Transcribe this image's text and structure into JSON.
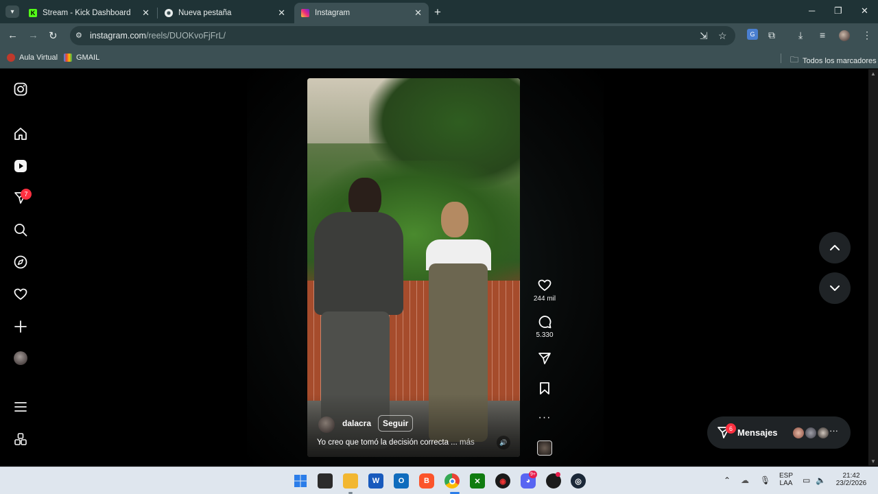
{
  "browser": {
    "tabs": [
      {
        "title": "Stream - Kick Dashboard",
        "favicon": "kick-icon",
        "color": "#53fc18"
      },
      {
        "title": "Nueva pestaña",
        "favicon": "chrome-icon",
        "color": "#e8edec"
      },
      {
        "title": "Instagram",
        "favicon": "instagram-icon",
        "color": "#e1306c",
        "active": true
      }
    ],
    "url_host": "instagram.com",
    "url_path": "/reels/DUOKvoFjFrL/",
    "bookmarks": [
      {
        "label": "Aula Virtual",
        "icon": "aula-virtual-icon"
      },
      {
        "label": "GMAIL",
        "icon": "gmail-icon"
      }
    ],
    "all_bookmarks_label": "Todos los marcadores"
  },
  "instagram": {
    "nav_badge_count": "7",
    "reel": {
      "username": "dalacra",
      "follow_label": "Seguir",
      "caption": "Yo creo que tomó la decisión correcta ...",
      "more_label": "más",
      "likes": "244 mil",
      "comments": "5.330"
    },
    "messages": {
      "label": "Mensajes",
      "badge_count": "6"
    }
  },
  "taskbar": {
    "language": "ESP",
    "layout": "LAA",
    "time": "21:42",
    "date": "23/2/2026",
    "discord_badge": "9+"
  },
  "colors": {
    "accent_red": "#ff3040",
    "chrome_frame": "#1f3336",
    "chrome_toolbar": "#3c5054"
  }
}
